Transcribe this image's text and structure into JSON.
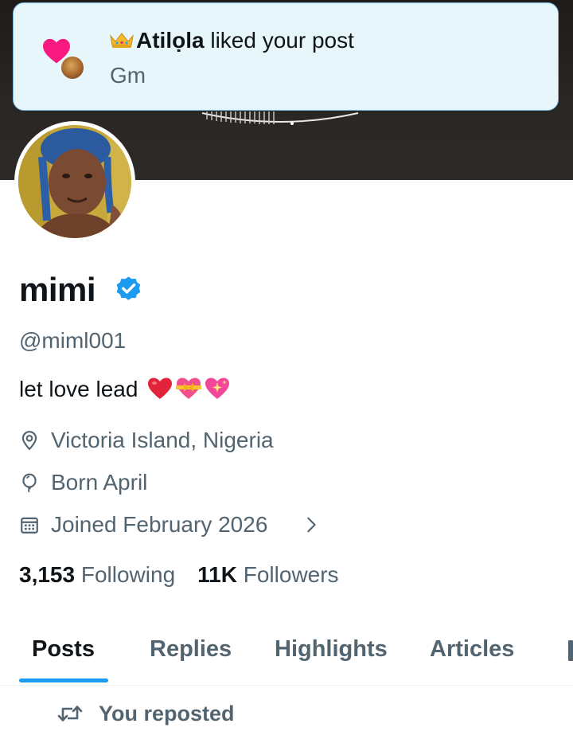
{
  "notification": {
    "name": "Atilọla",
    "action": " liked your post",
    "preview": "Gm",
    "icons": {
      "main": "heart-icon",
      "badge": "crown-emoji"
    },
    "colors": {
      "background": "#e7f6fb",
      "border": "#78b6e3",
      "heart": "#f91880"
    }
  },
  "profile": {
    "display_name": "mimi",
    "verified": true,
    "handle": "@miml001",
    "bio": "let love lead",
    "bio_emojis": [
      "red-heart-emoji",
      "heart-with-ribbon-emoji",
      "sparkling-heart-emoji"
    ],
    "location": "Victoria Island, Nigeria",
    "birthday": "Born April",
    "joined": "Joined February 2026",
    "following_count": "3,153",
    "following_label": "Following",
    "followers_count": "11K",
    "followers_label": "Followers"
  },
  "tabs": [
    {
      "label": "Posts",
      "active": true
    },
    {
      "label": "Replies",
      "active": false
    },
    {
      "label": "Highlights",
      "active": false
    },
    {
      "label": "Articles",
      "active": false
    }
  ],
  "feed": {
    "repost_label": "You reposted"
  },
  "colors": {
    "accent": "#1d9bf0",
    "text_primary": "#0f1419",
    "text_secondary": "#536471",
    "verified_badge": "#1d9bf0"
  }
}
